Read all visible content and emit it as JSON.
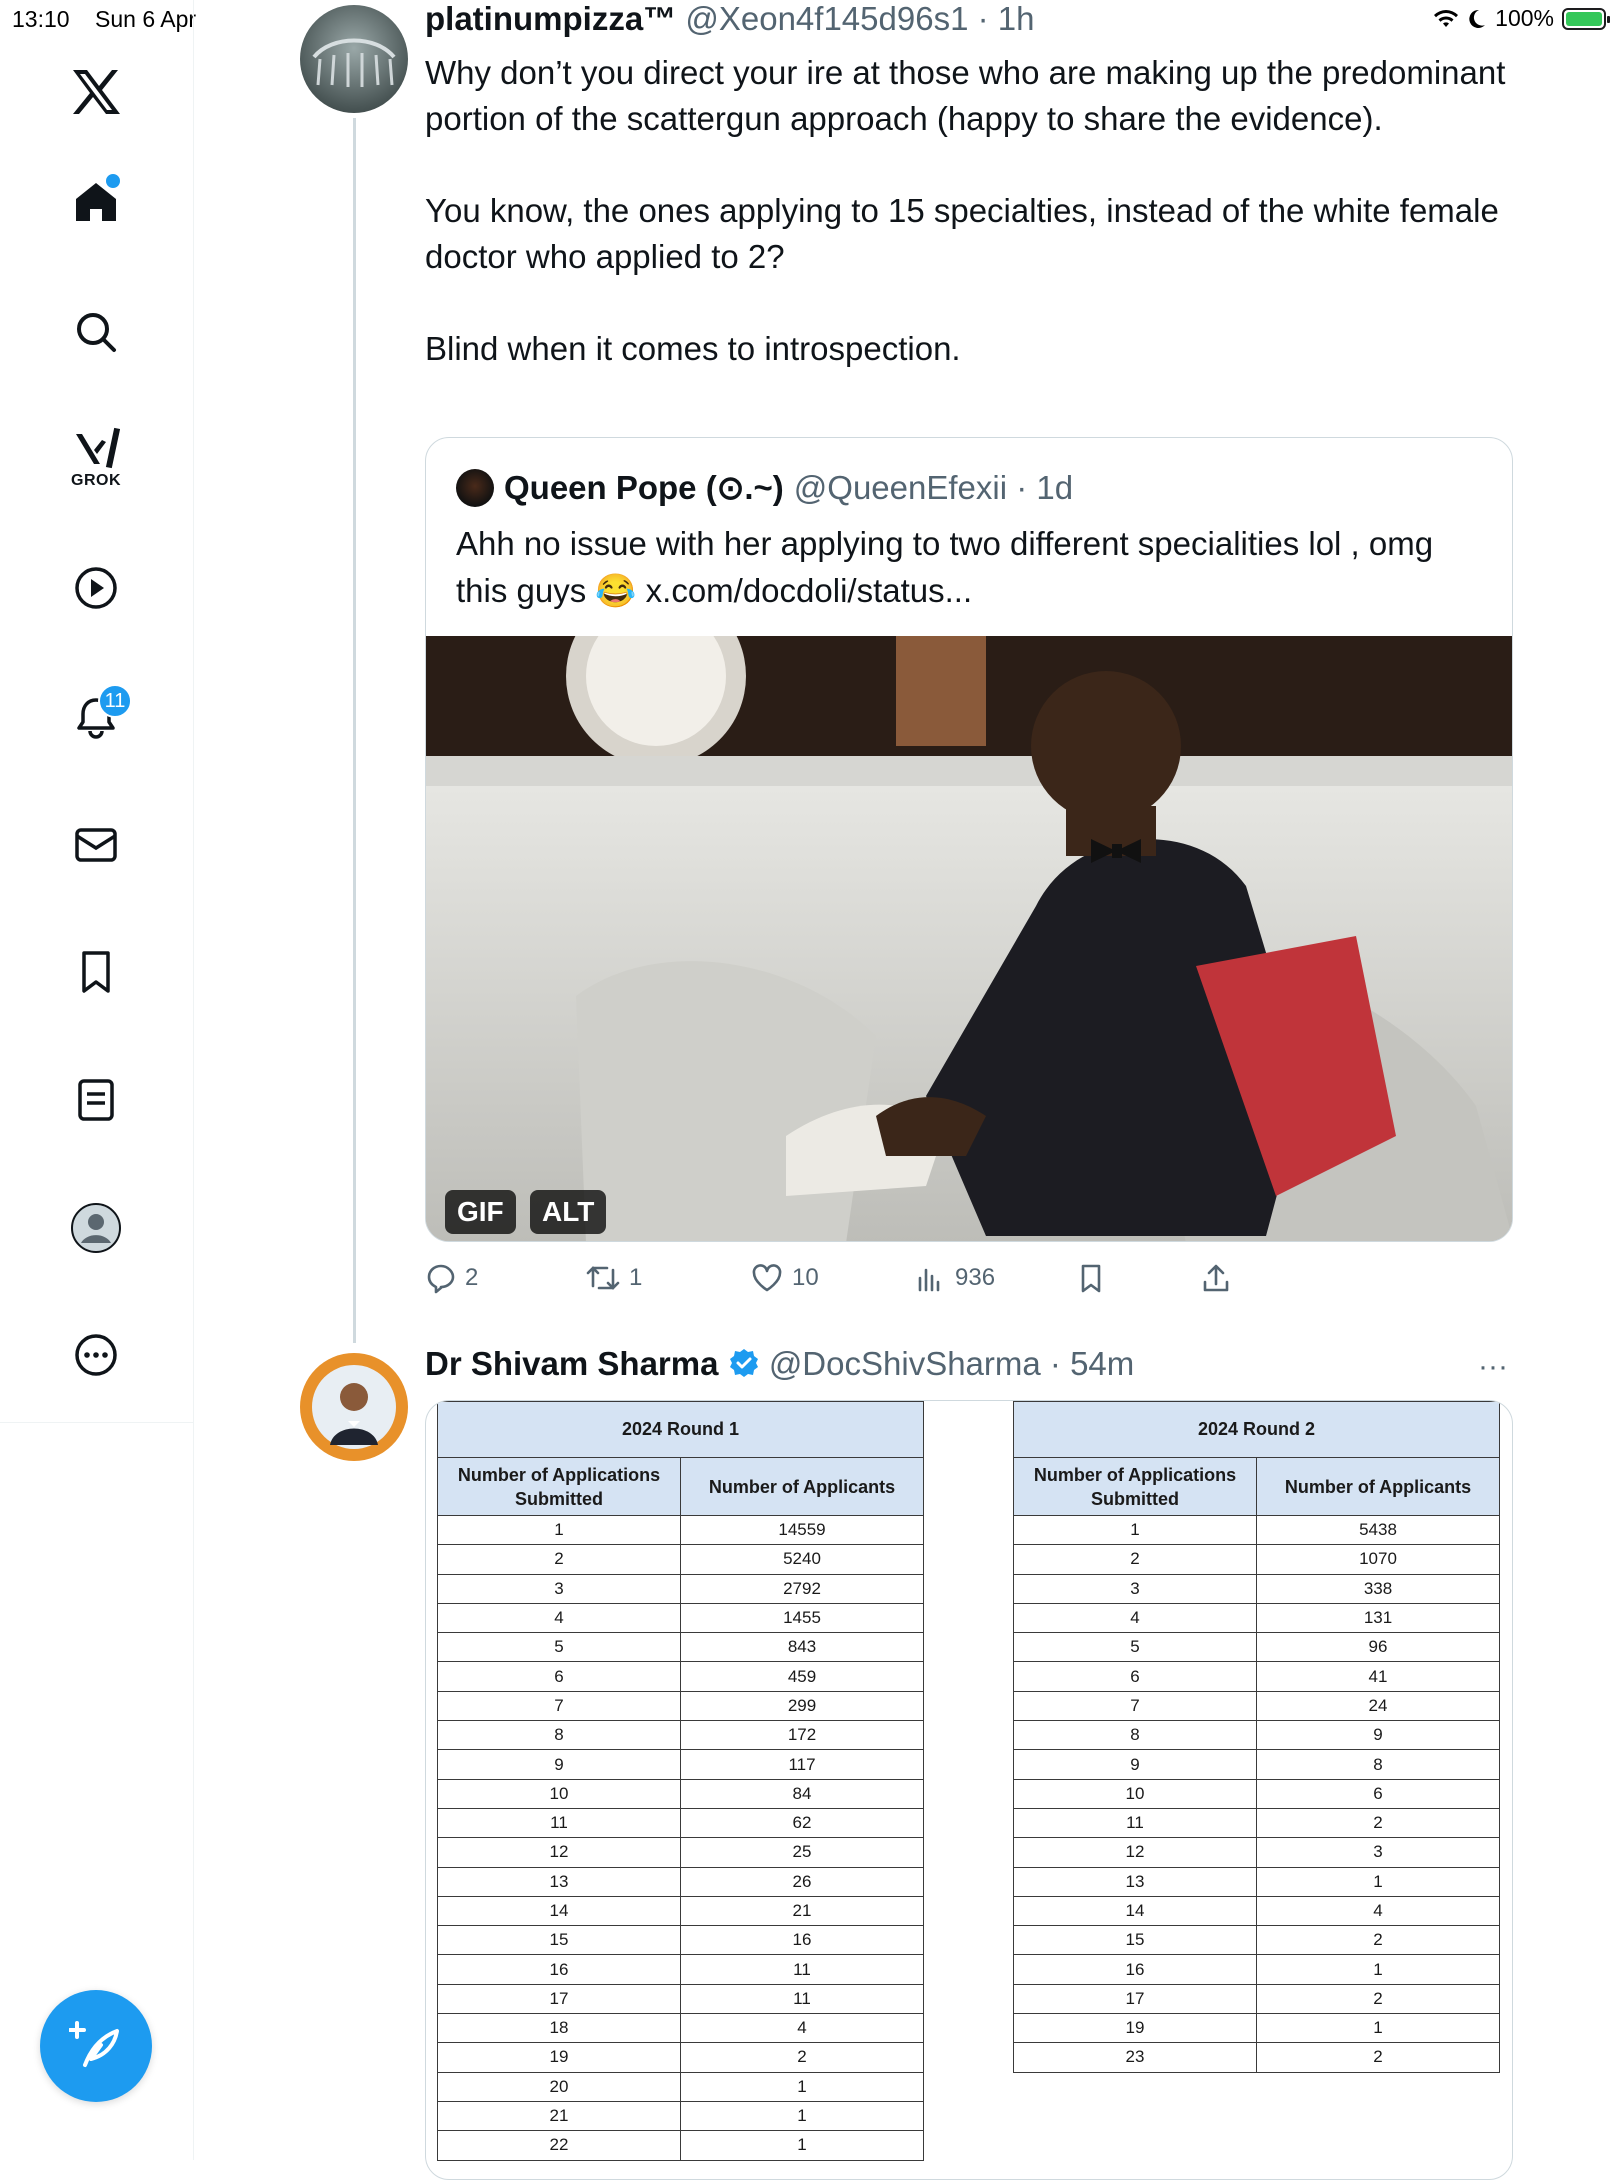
{
  "status_bar": {
    "time": "13:10",
    "date": "Sun 6 Apr",
    "battery": "100%",
    "battery_level": 1.0
  },
  "sidebar": {
    "grok_label": "GROK",
    "notifications_badge": "11",
    "items": [
      "x-logo-icon",
      "home-icon",
      "search-icon",
      "grok-icon",
      "video-icon",
      "notifications-icon",
      "messages-icon",
      "bookmarks-icon",
      "lists-icon",
      "profile-icon",
      "more-icon"
    ]
  },
  "tweet1": {
    "name": "platinumpizza™",
    "handle": "@Xeon4f145d96s1",
    "time": "1h",
    "text": [
      "Why don’t you direct your ire at those who are making up the predominant portion of the scattergun approach (happy to share the evidence).",
      "You know, the ones applying to 15 specialties, instead of the white female doctor who applied to 2?",
      "Blind when it comes to introspection."
    ],
    "quote": {
      "name": "Queen Pope (⊙.~)",
      "handle": "@QueenEfexii",
      "time": "1d",
      "text": "Ahh no issue with her applying to two different specialities lol , omg this guys 😂 x.com/docdoli/status...",
      "media_labels": [
        "GIF",
        "ALT"
      ]
    },
    "actions": {
      "replies": "2",
      "reposts": "1",
      "likes": "10",
      "views": "936"
    }
  },
  "tweet2": {
    "name": "Dr Shivam Sharma",
    "handle": "@DocShivSharma",
    "time": "54m",
    "more": "···",
    "table1": {
      "caption": "2024 Round 1",
      "headers": [
        "Number of Applications Submitted",
        "Number of Applicants"
      ],
      "rows": [
        [
          "1",
          "14559"
        ],
        [
          "2",
          "5240"
        ],
        [
          "3",
          "2792"
        ],
        [
          "4",
          "1455"
        ],
        [
          "5",
          "843"
        ],
        [
          "6",
          "459"
        ],
        [
          "7",
          "299"
        ],
        [
          "8",
          "172"
        ],
        [
          "9",
          "117"
        ],
        [
          "10",
          "84"
        ],
        [
          "11",
          "62"
        ],
        [
          "12",
          "25"
        ],
        [
          "13",
          "26"
        ],
        [
          "14",
          "21"
        ],
        [
          "15",
          "16"
        ],
        [
          "16",
          "11"
        ],
        [
          "17",
          "11"
        ],
        [
          "18",
          "4"
        ],
        [
          "19",
          "2"
        ],
        [
          "20",
          "1"
        ],
        [
          "21",
          "1"
        ],
        [
          "22",
          "1"
        ]
      ]
    },
    "table2": {
      "caption": "2024 Round 2",
      "headers": [
        "Number of Applications Submitted",
        "Number of Applicants"
      ],
      "rows": [
        [
          "1",
          "5438"
        ],
        [
          "2",
          "1070"
        ],
        [
          "3",
          "338"
        ],
        [
          "4",
          "131"
        ],
        [
          "5",
          "96"
        ],
        [
          "6",
          "41"
        ],
        [
          "7",
          "24"
        ],
        [
          "8",
          "9"
        ],
        [
          "9",
          "8"
        ],
        [
          "10",
          "6"
        ],
        [
          "11",
          "2"
        ],
        [
          "12",
          "3"
        ],
        [
          "13",
          "1"
        ],
        [
          "14",
          "4"
        ],
        [
          "15",
          "2"
        ],
        [
          "16",
          "1"
        ],
        [
          "17",
          "2"
        ],
        [
          "19",
          "1"
        ],
        [
          "23",
          "2"
        ]
      ]
    }
  },
  "colors": {
    "accent": "#1d9bf0",
    "text": "#0f1419",
    "muted": "#536471",
    "border": "#cfd9de",
    "table_header": "#d5e3f3"
  }
}
